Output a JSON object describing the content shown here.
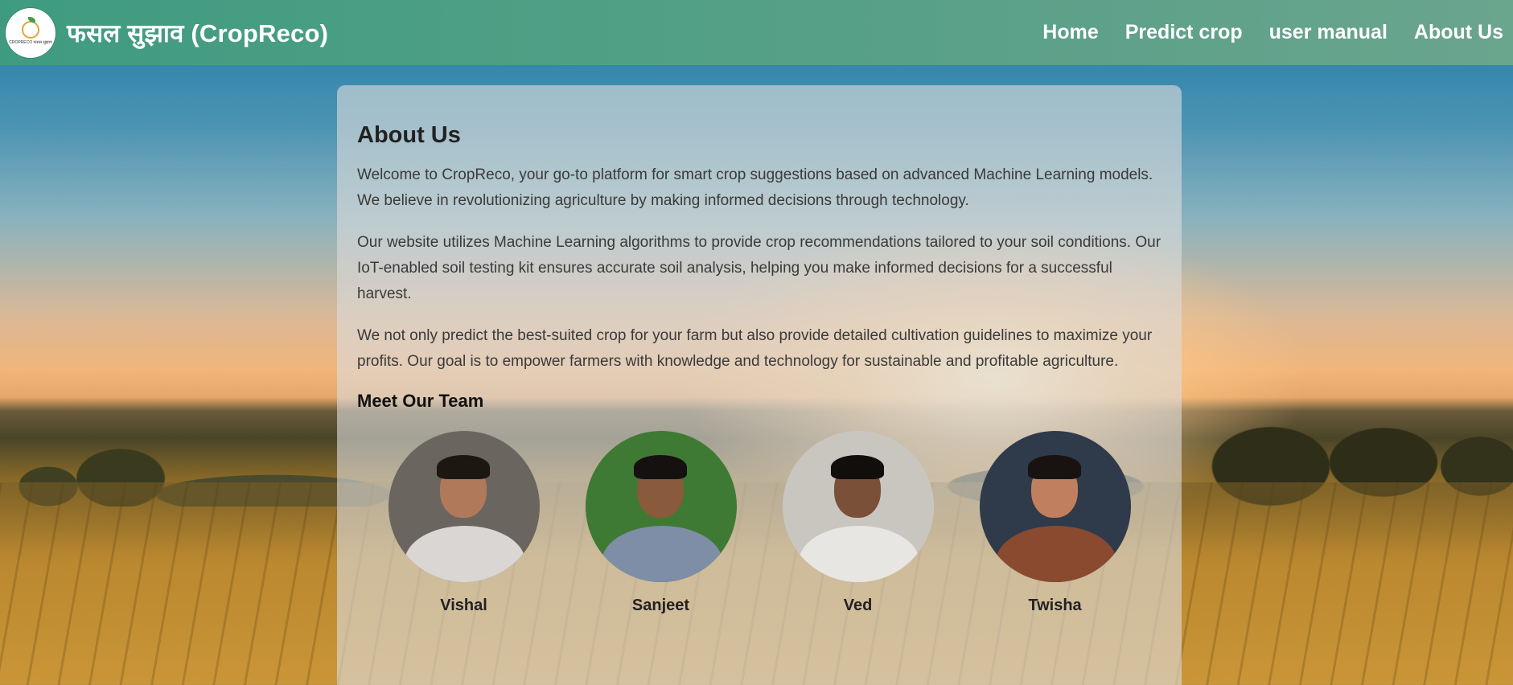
{
  "header": {
    "site_title": "फसल सुझाव (CropReco)",
    "logo_text": "CROPRECO फसल सुझाव",
    "nav": [
      {
        "label": "Home"
      },
      {
        "label": "Predict crop"
      },
      {
        "label": "user manual"
      },
      {
        "label": "About Us"
      }
    ]
  },
  "about": {
    "heading": "About Us",
    "paragraphs": [
      "Welcome to CropReco, your go-to platform for smart crop suggestions based on advanced Machine Learning models. We believe in revolutionizing agriculture by making informed decisions through technology.",
      "Our website utilizes Machine Learning algorithms to provide crop recommendations tailored to your soil conditions. Our IoT-enabled soil testing kit ensures accurate soil analysis, helping you make informed decisions for a successful harvest.",
      "We not only predict the best-suited crop for your farm but also provide detailed cultivation guidelines to maximize your profits. Our goal is to empower farmers with knowledge and technology for sustainable and profitable agriculture."
    ],
    "team_heading": "Meet Our Team",
    "team": [
      {
        "name": "Vishal",
        "bg": "#6b6560",
        "skin": "#b07a5a",
        "hair": "#1d1712",
        "shirt": "#d9d6d3"
      },
      {
        "name": "Sanjeet",
        "bg": "#3e7a34",
        "skin": "#8a5a3c",
        "hair": "#141110",
        "shirt": "#7d8ea6"
      },
      {
        "name": "Ved",
        "bg": "#c9c6c0",
        "skin": "#7a5038",
        "hair": "#120e0c",
        "shirt": "#e8e6e2"
      },
      {
        "name": "Twisha",
        "bg": "#2f3a4a",
        "skin": "#c08060",
        "hair": "#1a1210",
        "shirt": "#8a4a30"
      }
    ]
  }
}
